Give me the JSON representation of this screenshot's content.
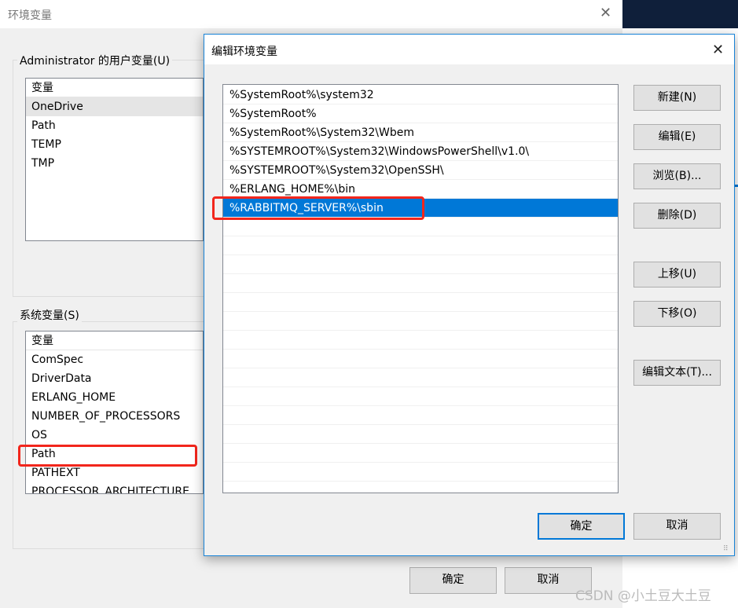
{
  "back_window": {
    "title": "环境变量",
    "user_group": "Administrator 的用户变量(U)",
    "user_header": "变量",
    "user_vars": [
      "OneDrive",
      "Path",
      "TEMP",
      "TMP"
    ],
    "system_group": "系统变量(S)",
    "system_header": "变量",
    "system_vars": [
      "ComSpec",
      "DriverData",
      "ERLANG_HOME",
      "NUMBER_OF_PROCESSORS",
      "OS",
      "Path",
      "PATHEXT",
      "PROCESSOR_ARCHITECTURE"
    ],
    "ok": "确定",
    "cancel": "取消"
  },
  "edit_dialog": {
    "title": "编辑环境变量",
    "paths": [
      "%SystemRoot%\\system32",
      "%SystemRoot%",
      "%SystemRoot%\\System32\\Wbem",
      "%SYSTEMROOT%\\System32\\WindowsPowerShell\\v1.0\\",
      "%SYSTEMROOT%\\System32\\OpenSSH\\",
      "%ERLANG_HOME%\\bin",
      "%RABBITMQ_SERVER%\\sbin"
    ],
    "selected_index": 6,
    "buttons": {
      "new": "新建(N)",
      "edit": "编辑(E)",
      "browse": "浏览(B)...",
      "delete": "删除(D)",
      "up": "上移(U)",
      "down": "下移(O)",
      "edit_text": "编辑文本(T)..."
    },
    "ok": "确定",
    "cancel": "取消"
  },
  "watermark": "CSDN @小土豆大土豆",
  "colors": {
    "selection": "#0078d7",
    "highlight_box": "#f2261c"
  }
}
